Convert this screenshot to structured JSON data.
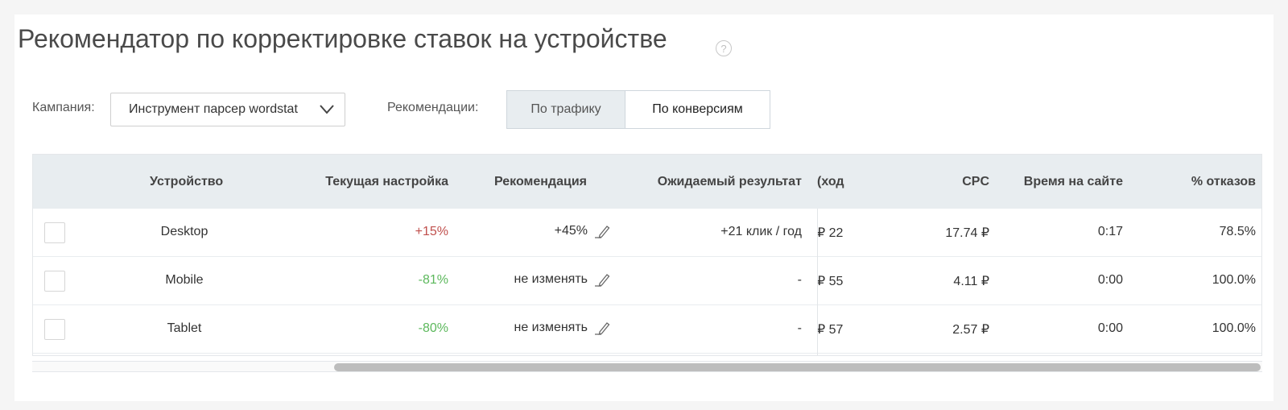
{
  "page": {
    "title": "Рекомендатор по корректировке ставок на устройстве",
    "help_icon": "?"
  },
  "filters": {
    "campaign_label": "Кампания:",
    "campaign_value": "Инструмент парсер wordstat",
    "recommendations_label": "Рекомендации:",
    "toggle": [
      {
        "label": "По трафику",
        "active": true
      },
      {
        "label": "По конверсиям",
        "active": false
      }
    ]
  },
  "table": {
    "headers": {
      "device": "Устройство",
      "current": "Текущая настройка",
      "recommendation": "Рекомендация",
      "expected": "Ожидаемый результат",
      "cost_partial": "ход)",
      "cpc": "CPC",
      "time": "Время на сайте",
      "bounce": "% отказов"
    },
    "rows": [
      {
        "device": "Desktop",
        "current": "+15%",
        "current_color": "#c0504d",
        "recommendation": "+45%",
        "expected": "+21 клик / год",
        "cost_partial": "22 ₽",
        "cpc": "17.74 ₽",
        "time": "0:17",
        "bounce": "78.5%"
      },
      {
        "device": "Mobile",
        "current": "-81%",
        "current_color": "#5cb85c",
        "recommendation": "не изменять",
        "expected": "-",
        "cost_partial": "55 ₽",
        "cpc": "4.11 ₽",
        "time": "0:00",
        "bounce": "100.0%"
      },
      {
        "device": "Tablet",
        "current": "-80%",
        "current_color": "#5cb85c",
        "recommendation": "не изменять",
        "expected": "-",
        "cost_partial": "57 ₽",
        "cpc": "2.57 ₽",
        "time": "0:00",
        "bounce": "100.0%"
      }
    ]
  },
  "colors": {
    "positive": "#5cb85c",
    "negative": "#c0504d",
    "header_bg": "#e8edf0"
  },
  "icons": {
    "help": "question-circle-icon",
    "dropdown": "chevron-down-icon",
    "edit": "pencil-icon"
  },
  "scroll": {
    "horizontal_position": 0.25
  }
}
